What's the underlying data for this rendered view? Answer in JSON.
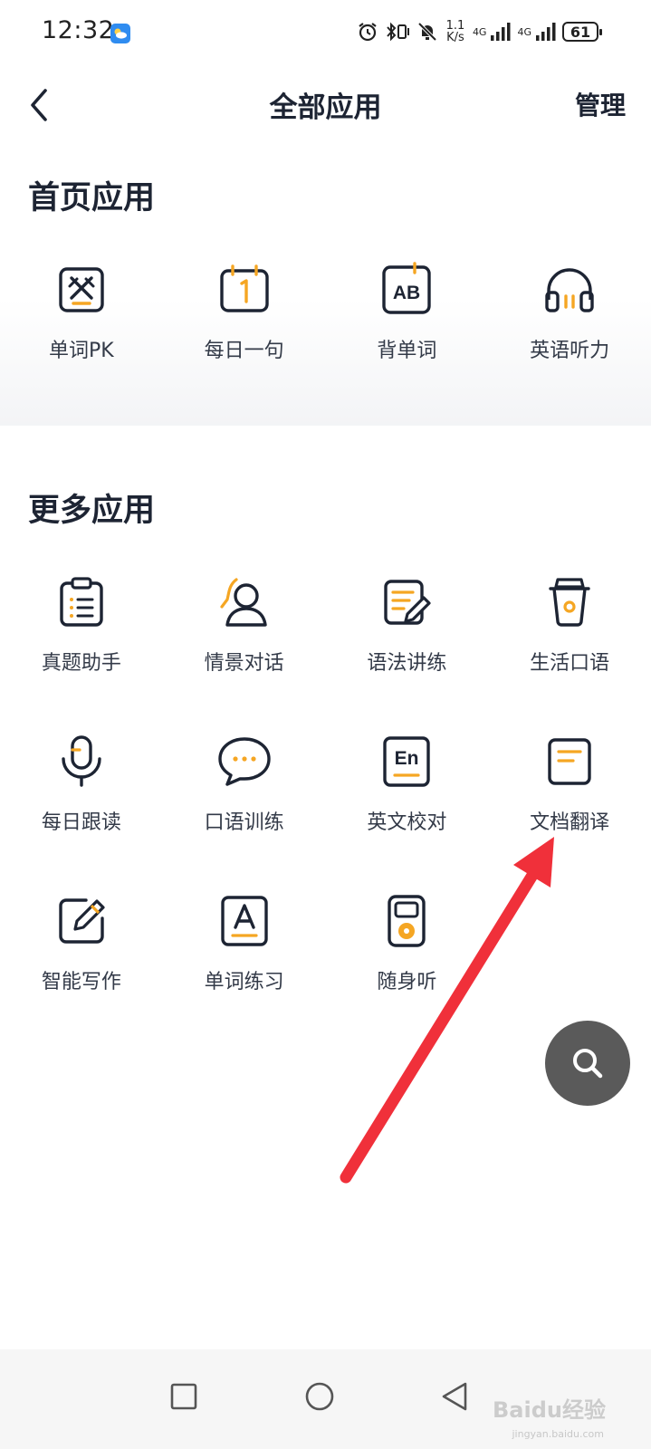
{
  "status_bar": {
    "time": "12:32",
    "net_speed_value": "1.1",
    "net_speed_unit": "K/s",
    "sim1_label": "4G",
    "sim2_label": "4G",
    "battery": "61"
  },
  "header": {
    "title": "全部应用",
    "manage_label": "管理"
  },
  "sections": {
    "home_apps_title": "首页应用",
    "more_apps_title": "更多应用"
  },
  "home_apps": [
    {
      "label": "单词PK",
      "icon": "word-pk-icon"
    },
    {
      "label": "每日一句",
      "icon": "calendar-icon"
    },
    {
      "label": "背单词",
      "icon": "ab-card-icon"
    },
    {
      "label": "英语听力",
      "icon": "headphones-icon"
    }
  ],
  "more_apps": [
    {
      "label": "真题助手",
      "icon": "clipboard-icon"
    },
    {
      "label": "情景对话",
      "icon": "person-icon"
    },
    {
      "label": "语法讲练",
      "icon": "edit-note-icon"
    },
    {
      "label": "生活口语",
      "icon": "cup-icon"
    },
    {
      "label": "每日跟读",
      "icon": "microphone-icon"
    },
    {
      "label": "口语训练",
      "icon": "chat-bubble-icon"
    },
    {
      "label": "英文校对",
      "icon": "en-card-icon"
    },
    {
      "label": "文档翻译",
      "icon": "document-icon"
    },
    {
      "label": "智能写作",
      "icon": "pen-write-icon"
    },
    {
      "label": "单词练习",
      "icon": "letter-a-icon"
    },
    {
      "label": "随身听",
      "icon": "music-player-icon"
    }
  ],
  "watermark": {
    "text": "Baidu经验",
    "sub": "jingyan.baidu.com"
  },
  "colors": {
    "icon_stroke": "#1d2433",
    "accent": "#f5a623",
    "arrow": "#f0303a",
    "fab": "#5a5a5a"
  }
}
